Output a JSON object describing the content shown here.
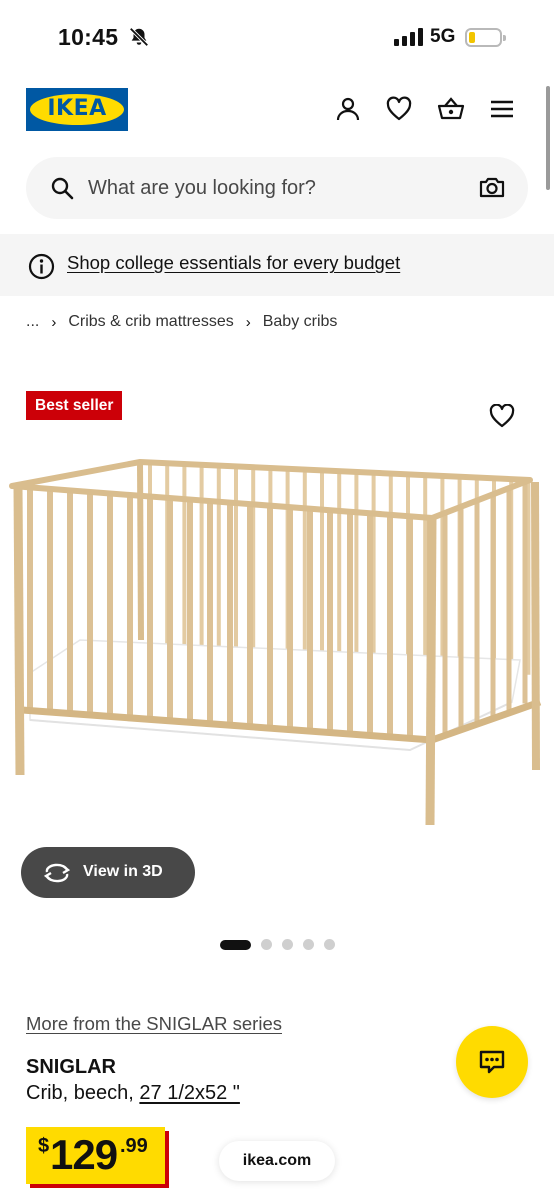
{
  "status_bar": {
    "time": "10:45",
    "network": "5G"
  },
  "header": {
    "logo_text": "IKEA"
  },
  "search": {
    "placeholder": "What are you looking for?"
  },
  "banner": {
    "text": "Shop college essentials for every budget"
  },
  "breadcrumb": {
    "ellipsis": "...",
    "items": [
      "Cribs & crib mattresses",
      "Baby cribs"
    ]
  },
  "product": {
    "badge": "Best seller",
    "view3d_label": "View in 3D",
    "carousel": {
      "total": 5,
      "active": 1
    },
    "series_link": "More from the SNIGLAR series",
    "name": "SNIGLAR",
    "desc_prefix": "Crib, beech, ",
    "dimensions": "27 1/2x52 \"",
    "price": {
      "currency": "$",
      "integer": "129",
      "decimal": ".99"
    }
  },
  "browser": {
    "domain": "ikea.com"
  },
  "colors": {
    "ikea_blue": "#0058a3",
    "ikea_yellow": "#ffdb00",
    "badge_red": "#cc0008",
    "dark_pill": "#484848"
  },
  "icons": [
    "bell-off-icon",
    "signal-icon",
    "battery-icon",
    "profile-icon",
    "heart-icon",
    "basket-icon",
    "menu-icon",
    "search-icon",
    "camera-icon",
    "info-icon",
    "rotate-3d-icon",
    "chat-icon"
  ]
}
